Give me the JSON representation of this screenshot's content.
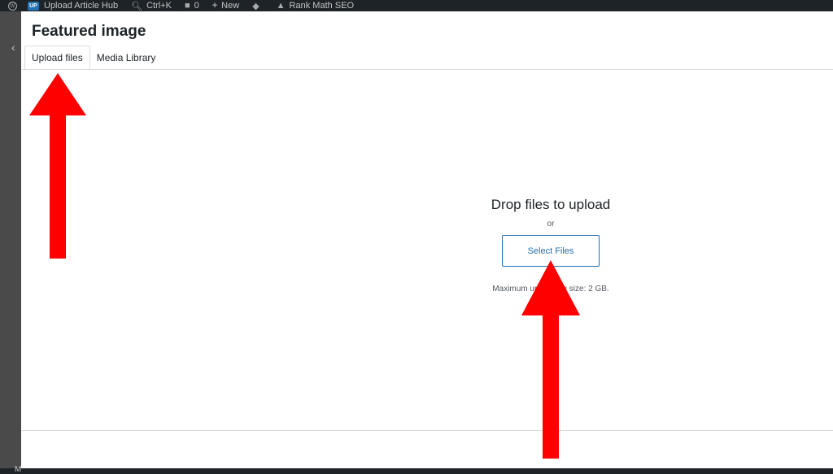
{
  "adminbar": {
    "wp_icon": "wordpress-icon",
    "site_badge": "UP",
    "site_name": "Upload Article Hub",
    "search_shortcut": "Ctrl+K",
    "comments_count": "0",
    "new_label": "New",
    "rankmath_label": "Rank Math SEO"
  },
  "modal": {
    "title": "Featured image",
    "tabs": [
      {
        "label": "Upload files",
        "active": true
      },
      {
        "label": "Media Library",
        "active": false
      }
    ]
  },
  "upload": {
    "drop_title": "Drop files to upload",
    "or_text": "or",
    "select_button": "Select Files",
    "max_size_text": "Maximum upload file size: 2 GB."
  },
  "backdrop": {
    "edge_letter": "M"
  },
  "colors": {
    "accent": "#2271b1",
    "annotation_arrow": "#ff0000",
    "adminbar_bg": "#1d2327"
  }
}
